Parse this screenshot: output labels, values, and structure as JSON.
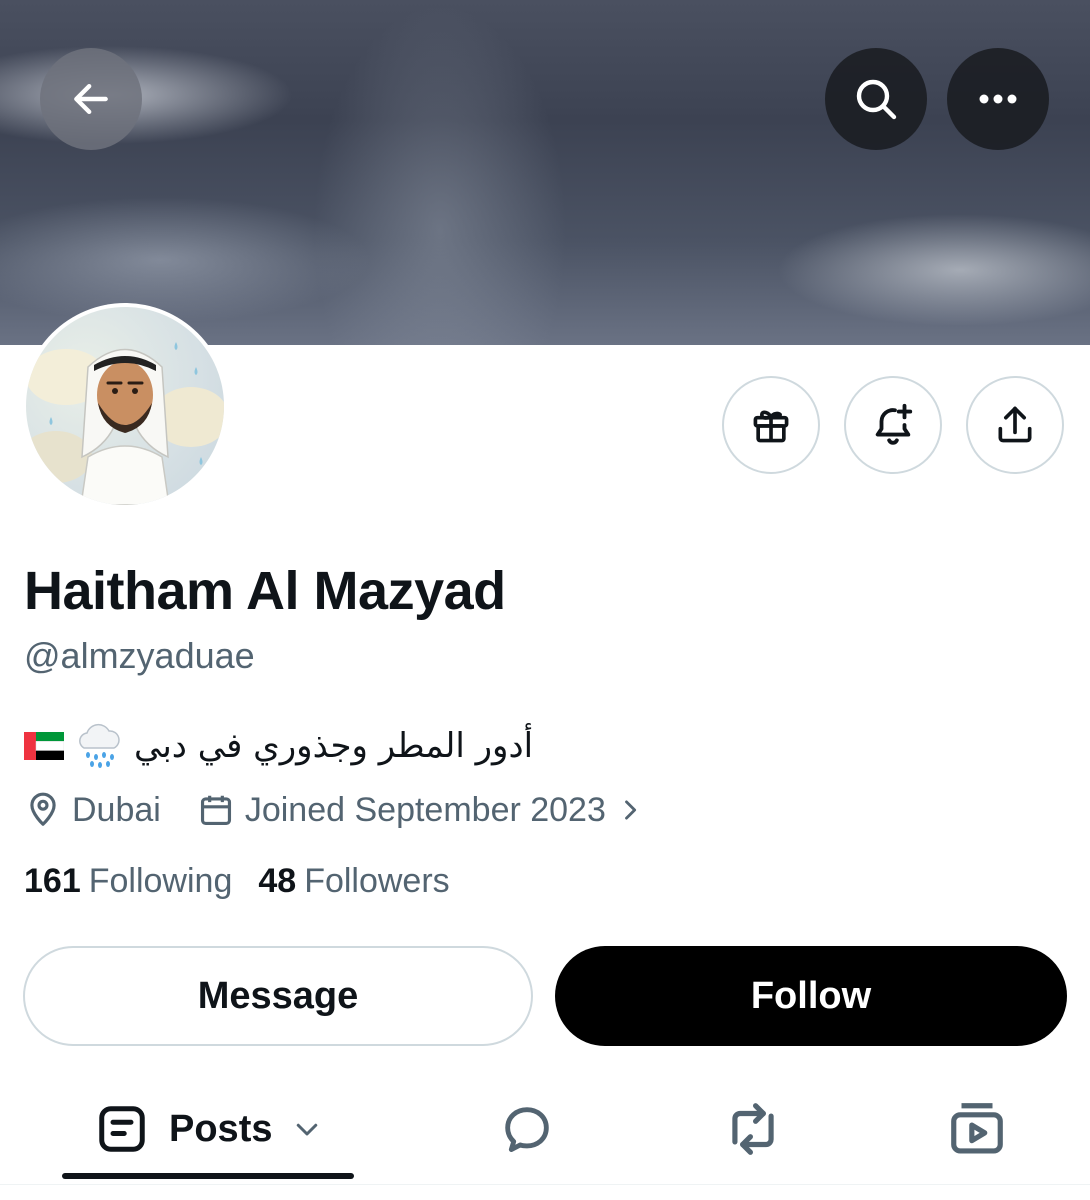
{
  "profile": {
    "name": "Haitham Al Mazyad",
    "handle": "@almzyaduae",
    "bio_text": "أدور المطر وجذوري في دبي",
    "bio_emoji": [
      "cloud-with-rain",
      "uae-flag"
    ],
    "location": "Dubai",
    "joined": "Joined September 2023"
  },
  "stats": {
    "following_count": "161",
    "following_label": "Following",
    "followers_count": "48",
    "followers_label": "Followers"
  },
  "buttons": {
    "message_label": "Message",
    "follow_label": "Follow"
  },
  "tabs": {
    "posts_label": "Posts"
  },
  "icons": {
    "header": [
      "back-arrow-icon",
      "search-icon",
      "more-icon"
    ],
    "actions": [
      "gift-icon",
      "notification-bell-icon",
      "share-icon"
    ],
    "tabs": [
      "posts-icon",
      "replies-icon",
      "reposts-icon",
      "media-icon"
    ]
  },
  "colors": {
    "text_primary": "#0f1419",
    "text_secondary": "#536471",
    "border": "#cfd9de",
    "follow_bg": "#000000"
  }
}
